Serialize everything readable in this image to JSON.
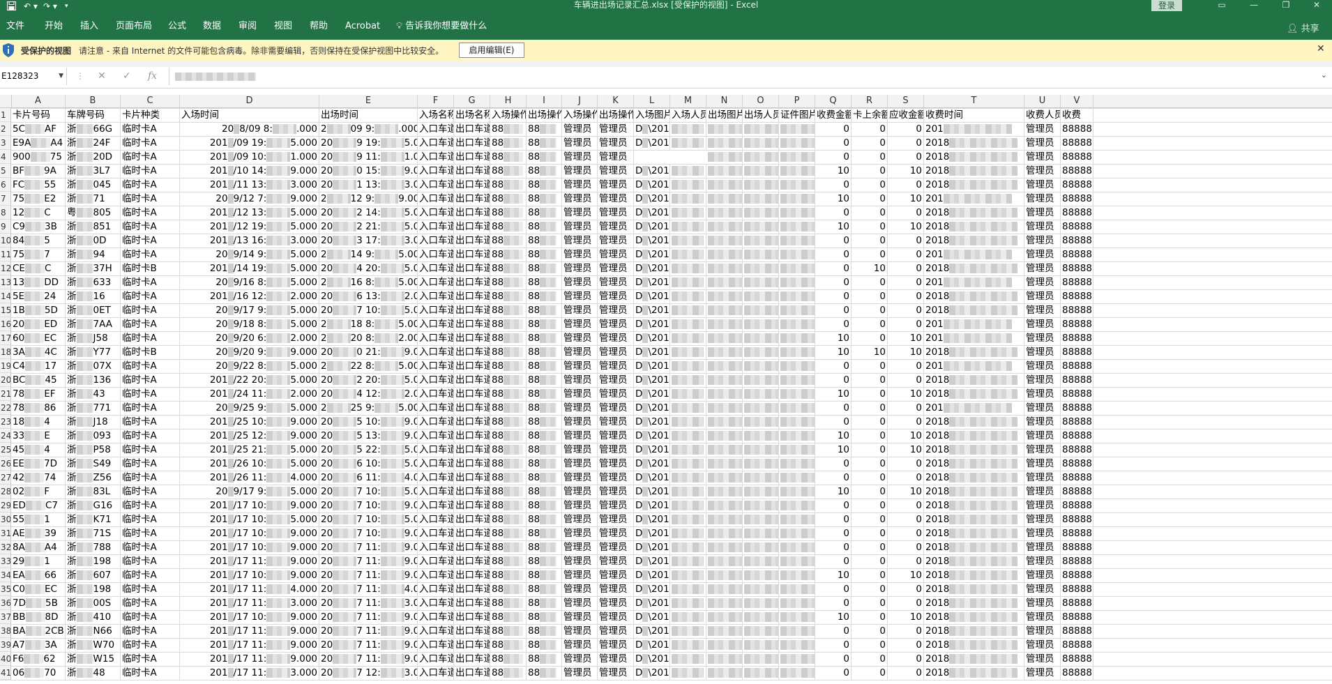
{
  "window": {
    "title": "车辆进出场记录汇总.xlsx  [受保护的视图]  -  Excel",
    "login": "登录",
    "share": "共享"
  },
  "ribbon": {
    "tabs": [
      "文件",
      "开始",
      "插入",
      "页面布局",
      "公式",
      "数据",
      "审阅",
      "视图",
      "帮助",
      "Acrobat"
    ],
    "tell_me": "告诉我你想要做什么"
  },
  "protected": {
    "label": "受保护的视图",
    "message": "请注意 - 来自 Internet 的文件可能包含病毒。除非需要编辑，否则保持在受保护视图中比较安全。",
    "enable_button": "启用编辑(E)"
  },
  "formula": {
    "name_box": "E128323",
    "fx": "fx"
  },
  "columns": [
    "A",
    "B",
    "C",
    "D",
    "E",
    "F",
    "G",
    "H",
    "I",
    "J",
    "K",
    "L",
    "M",
    "N",
    "O",
    "P",
    "Q",
    "R",
    "S",
    "T",
    "U",
    "V"
  ],
  "header_row": [
    "卡片号码",
    "车牌号码",
    "卡片种类",
    "入场时间",
    "出场时间",
    "入场名称",
    "出场名称",
    "入场操作",
    "出场操作",
    "入场操作",
    "出场操作",
    "入场图片",
    "入场人员",
    "出场图片",
    "出场人员",
    "证件图片",
    "收费金额",
    "卡上余额",
    "应收金额",
    "收费时间",
    "收费人员",
    "收费"
  ],
  "rows": [
    {
      "n": "2",
      "a": "5C",
      "a2": "AF",
      "b": "浙",
      "b2": "66G",
      "c": "临时卡A",
      "d1": "20",
      "d2": "8/09 8:",
      "e1": "2",
      "e2": "09 9:",
      "e3": ".000",
      "q": "0",
      "r": "0",
      "s": "0",
      "t": "201"
    },
    {
      "n": "3",
      "a": "E9A",
      "a2": "A4",
      "b": "浙",
      "b2": "24F",
      "c": "临时卡A",
      "d1": "201",
      "d2": "/09 19:",
      "e1": "20",
      "e2": "9 19:",
      "e3": "5.000",
      "q": "0",
      "r": "0",
      "s": "0",
      "t": "2018"
    },
    {
      "n": "4",
      "a": "900",
      "a2": "75",
      "b": "浙",
      "b2": "20D",
      "c": "临时卡A",
      "d1": "201",
      "d2": "/09 10:",
      "e1": "20",
      "e2": "9 11:",
      "e3": "1.000",
      "q": "0",
      "r": "0",
      "s": "0",
      "t": "2018"
    },
    {
      "n": "5",
      "a": "BF",
      "a2": "9A",
      "b": "浙",
      "b2": "3L7",
      "c": "临时卡A",
      "d1": "201",
      "d2": "/10 14:",
      "e1": "20",
      "e2": "0 15:",
      "e3": "9.000",
      "q": "10",
      "r": "0",
      "s": "10",
      "t": "2018"
    },
    {
      "n": "6",
      "a": "FC",
      "a2": "55",
      "b": "浙",
      "b2": "045",
      "c": "临时卡A",
      "d1": "201",
      "d2": "/11 13:",
      "e1": "20",
      "e2": "1 13:",
      "e3": "3.000",
      "q": "0",
      "r": "0",
      "s": "0",
      "t": "2018"
    },
    {
      "n": "7",
      "a": "75",
      "a2": "E2",
      "b": "浙",
      "b2": "71",
      "c": "临时卡A",
      "d1": "20",
      "d2": "9/12 7:",
      "e1": "2",
      "e2": "12 9:",
      "e3": "9.000",
      "q": "10",
      "r": "0",
      "s": "10",
      "t": "201"
    },
    {
      "n": "8",
      "a": "12",
      "a2": "C",
      "b": "粤",
      "b2": "805",
      "c": "临时卡A",
      "d1": "201",
      "d2": "/12 13:",
      "e1": "20",
      "e2": "2 14:",
      "e3": "5.000",
      "q": "0",
      "r": "0",
      "s": "0",
      "t": "2018"
    },
    {
      "n": "9",
      "a": "C9",
      "a2": "3B",
      "b": "浙",
      "b2": "851",
      "c": "临时卡A",
      "d1": "201",
      "d2": "/12 19:",
      "e1": "20",
      "e2": "2 21:",
      "e3": "5.000",
      "q": "10",
      "r": "0",
      "s": "10",
      "t": "2018"
    },
    {
      "n": "10",
      "a": "84",
      "a2": "5",
      "b": "浙",
      "b2": "0D",
      "c": "临时卡A",
      "d1": "201",
      "d2": "/13 16:",
      "e1": "20",
      "e2": "3 17:",
      "e3": "3.000",
      "q": "0",
      "r": "0",
      "s": "0",
      "t": "2018"
    },
    {
      "n": "11",
      "a": "75",
      "a2": "7",
      "b": "浙",
      "b2": "94",
      "c": "临时卡A",
      "d1": "20",
      "d2": "9/14 9:",
      "e1": "2",
      "e2": "14 9:",
      "e3": "5.000",
      "q": "0",
      "r": "0",
      "s": "0",
      "t": "201"
    },
    {
      "n": "12",
      "a": "CE",
      "a2": "C",
      "b": "浙",
      "b2": "37H",
      "c": "临时卡B",
      "d1": "201",
      "d2": "/14 19:",
      "e1": "20",
      "e2": "4 20:",
      "e3": "5.000",
      "q": "0",
      "r": "10",
      "s": "0",
      "t": "2018"
    },
    {
      "n": "13",
      "a": "13",
      "a2": "DD",
      "b": "浙",
      "b2": "633",
      "c": "临时卡A",
      "d1": "20",
      "d2": "9/16 8:",
      "e1": "2",
      "e2": "16 8:",
      "e3": "5.000",
      "q": "0",
      "r": "0",
      "s": "0",
      "t": "201"
    },
    {
      "n": "14",
      "a": "5E",
      "a2": "24",
      "b": "浙",
      "b2": "16",
      "c": "临时卡A",
      "d1": "201",
      "d2": "/16 12:",
      "e1": "20",
      "e2": "6 13:",
      "e3": "2.000",
      "q": "0",
      "r": "0",
      "s": "0",
      "t": "2018"
    },
    {
      "n": "15",
      "a": "1B",
      "a2": "5D",
      "b": "浙",
      "b2": "0ET",
      "c": "临时卡A",
      "d1": "20",
      "d2": "9/17 9:",
      "e1": "20",
      "e2": "7 10:",
      "e3": "5.000",
      "q": "0",
      "r": "0",
      "s": "0",
      "t": "2018"
    },
    {
      "n": "16",
      "a": "20",
      "a2": "ED",
      "b": "浙",
      "b2": "7AA",
      "c": "临时卡A",
      "d1": "20",
      "d2": "9/18 8:",
      "e1": "2",
      "e2": "18 8:",
      "e3": "5.000",
      "q": "0",
      "r": "0",
      "s": "0",
      "t": "201"
    },
    {
      "n": "17",
      "a": "60",
      "a2": "EC",
      "b": "浙",
      "b2": "J58",
      "c": "临时卡A",
      "d1": "20",
      "d2": "9/20 6:",
      "e1": "2",
      "e2": "20 8:",
      "e3": "2.000",
      "q": "10",
      "r": "0",
      "s": "10",
      "t": "201"
    },
    {
      "n": "18",
      "a": "3A",
      "a2": "4C",
      "b": "浙",
      "b2": "Y77",
      "c": "临时卡B",
      "d1": "20",
      "d2": "9/20 9:",
      "e1": "20",
      "e2": "0 21:",
      "e3": "9.000",
      "q": "10",
      "r": "10",
      "s": "10",
      "t": "2018"
    },
    {
      "n": "19",
      "a": "C4",
      "a2": "17",
      "b": "浙",
      "b2": "07X",
      "c": "临时卡A",
      "d1": "20",
      "d2": "9/22 8:",
      "e1": "2",
      "e2": "22 8:",
      "e3": "5.000",
      "q": "0",
      "r": "0",
      "s": "0",
      "t": "201"
    },
    {
      "n": "20",
      "a": "BC",
      "a2": "45",
      "b": "浙",
      "b2": "136",
      "c": "临时卡A",
      "d1": "201",
      "d2": "/22 20:",
      "e1": "20",
      "e2": "2 20:",
      "e3": "5.000",
      "q": "0",
      "r": "0",
      "s": "0",
      "t": "2018"
    },
    {
      "n": "21",
      "a": "78",
      "a2": "EF",
      "b": "浙",
      "b2": "43",
      "c": "临时卡A",
      "d1": "201",
      "d2": "/24 11:",
      "e1": "20",
      "e2": "4 12:",
      "e3": "2.000",
      "q": "10",
      "r": "0",
      "s": "10",
      "t": "2018"
    },
    {
      "n": "22",
      "a": "78",
      "a2": "86",
      "b": "浙",
      "b2": "771",
      "c": "临时卡A",
      "d1": "20",
      "d2": "9/25 9:",
      "e1": "2",
      "e2": "25 9:",
      "e3": "5.000",
      "q": "0",
      "r": "0",
      "s": "0",
      "t": "201"
    },
    {
      "n": "23",
      "a": "18",
      "a2": "4",
      "b": "浙",
      "b2": "J18",
      "c": "临时卡A",
      "d1": "201",
      "d2": "/25 10:",
      "e1": "20",
      "e2": "5 10:",
      "e3": "9.000",
      "q": "0",
      "r": "0",
      "s": "0",
      "t": "2018"
    },
    {
      "n": "24",
      "a": "33",
      "a2": "E",
      "b": "浙",
      "b2": "093",
      "c": "临时卡A",
      "d1": "201",
      "d2": "/25 12:",
      "e1": "20",
      "e2": "5 13:",
      "e3": "9.000",
      "q": "10",
      "r": "0",
      "s": "10",
      "t": "2018"
    },
    {
      "n": "25",
      "a": "45",
      "a2": "4",
      "b": "浙",
      "b2": "P58",
      "c": "临时卡A",
      "d1": "201",
      "d2": "/25 21:",
      "e1": "20",
      "e2": "5 22:",
      "e3": "5.000",
      "q": "10",
      "r": "0",
      "s": "10",
      "t": "2018"
    },
    {
      "n": "26",
      "a": "EE",
      "a2": "7D",
      "b": "浙",
      "b2": "S49",
      "c": "临时卡A",
      "d1": "201",
      "d2": "/26 10:",
      "e1": "20",
      "e2": "6 10:",
      "e3": "5.000",
      "q": "0",
      "r": "0",
      "s": "0",
      "t": "2018"
    },
    {
      "n": "27",
      "a": "42",
      "a2": "74",
      "b": "浙",
      "b2": "Z56",
      "c": "临时卡A",
      "d1": "201",
      "d2": "/26 11:",
      "e1": "20",
      "e2": "6 11:",
      "e3": "4.000",
      "q": "0",
      "r": "0",
      "s": "0",
      "t": "2018"
    },
    {
      "n": "28",
      "a": "02",
      "a2": "F",
      "b": "浙",
      "b2": "83L",
      "c": "临时卡A",
      "d1": "20",
      "d2": "9/17 9:",
      "e1": "20",
      "e2": "7 10:",
      "e3": "5.000",
      "q": "10",
      "r": "0",
      "s": "10",
      "t": "2018"
    },
    {
      "n": "29",
      "a": "ED",
      "a2": "C7",
      "b": "浙",
      "b2": "G16",
      "c": "临时卡A",
      "d1": "201",
      "d2": "/17 10:",
      "e1": "20",
      "e2": "7 10:",
      "e3": "9.000",
      "q": "0",
      "r": "0",
      "s": "0",
      "t": "2018"
    },
    {
      "n": "30",
      "a": "55",
      "a2": "1",
      "b": "浙",
      "b2": "K71",
      "c": "临时卡A",
      "d1": "201",
      "d2": "/17 10:",
      "e1": "20",
      "e2": "7 10:",
      "e3": "5.000",
      "q": "0",
      "r": "0",
      "s": "0",
      "t": "2018"
    },
    {
      "n": "31",
      "a": "AE",
      "a2": "39",
      "b": "浙",
      "b2": "71S",
      "c": "临时卡A",
      "d1": "201",
      "d2": "/17 10:",
      "e1": "20",
      "e2": "7 10:",
      "e3": "9.000",
      "q": "0",
      "r": "0",
      "s": "0",
      "t": "2018"
    },
    {
      "n": "32",
      "a": "8A",
      "a2": "A4",
      "b": "浙",
      "b2": "788",
      "c": "临时卡A",
      "d1": "201",
      "d2": "/17 10:",
      "e1": "20",
      "e2": "7 11:",
      "e3": "9.000",
      "q": "0",
      "r": "0",
      "s": "0",
      "t": "2018"
    },
    {
      "n": "33",
      "a": "29",
      "a2": "1",
      "b": "浙",
      "b2": "198",
      "c": "临时卡A",
      "d1": "201",
      "d2": "/17 11:",
      "e1": "20",
      "e2": "7 11:",
      "e3": "9.000",
      "q": "0",
      "r": "0",
      "s": "0",
      "t": "2018"
    },
    {
      "n": "34",
      "a": "EA",
      "a2": "66",
      "b": "浙",
      "b2": "607",
      "c": "临时卡A",
      "d1": "201",
      "d2": "/17 10:",
      "e1": "20",
      "e2": "7 11:",
      "e3": "9.000",
      "q": "10",
      "r": "0",
      "s": "10",
      "t": "2018"
    },
    {
      "n": "35",
      "a": "C0",
      "a2": "EC",
      "b": "浙",
      "b2": "198",
      "c": "临时卡A",
      "d1": "201",
      "d2": "/17 11:",
      "e1": "20",
      "e2": "7 11:",
      "e3": "4.000",
      "q": "0",
      "r": "0",
      "s": "0",
      "t": "2018"
    },
    {
      "n": "36",
      "a": "7D",
      "a2": "5B",
      "b": "浙",
      "b2": "00S",
      "c": "临时卡A",
      "d1": "201",
      "d2": "/17 11:",
      "e1": "20",
      "e2": "7 11:",
      "e3": "3.000",
      "q": "0",
      "r": "0",
      "s": "0",
      "t": "2018"
    },
    {
      "n": "37",
      "a": "BB",
      "a2": "8D",
      "b": "浙",
      "b2": "410",
      "c": "临时卡A",
      "d1": "201",
      "d2": "/17 10:",
      "e1": "20",
      "e2": "7 11:",
      "e3": "9.000",
      "q": "10",
      "r": "0",
      "s": "10",
      "t": "2018"
    },
    {
      "n": "38",
      "a": "BA",
      "a2": "2CB",
      "b": "浙",
      "b2": "N66",
      "c": "临时卡A",
      "d1": "201",
      "d2": "/17 11:",
      "e1": "20",
      "e2": "7 11:",
      "e3": "9.000",
      "q": "0",
      "r": "0",
      "s": "0",
      "t": "2018"
    },
    {
      "n": "39",
      "a": "A7",
      "a2": "3A",
      "b": "浙",
      "b2": "W70",
      "c": "临时卡A",
      "d1": "201",
      "d2": "/17 11:",
      "e1": "20",
      "e2": "7 11:",
      "e3": "9.000",
      "q": "0",
      "r": "0",
      "s": "0",
      "t": "2018"
    },
    {
      "n": "40",
      "a": "F6",
      "a2": "62",
      "b": "浙",
      "b2": "W15",
      "c": "临时卡A",
      "d1": "201",
      "d2": "/17 11:",
      "e1": "20",
      "e2": "7 11:",
      "e3": "9.000",
      "q": "0",
      "r": "0",
      "s": "0",
      "t": "2018"
    },
    {
      "n": "41",
      "a": "06",
      "a2": "70",
      "b": "浙",
      "b2": "48",
      "c": "临时卡A",
      "d1": "201",
      "d2": "/17 11:",
      "e1": "20",
      "e2": "7 12:",
      "e3": "3.000",
      "q": "0",
      "r": "0",
      "s": "0",
      "t": "2018"
    }
  ],
  "repeated": {
    "entry_name": "入口车道",
    "exit_name": "出口车道",
    "op_h": "88",
    "op_i": "88",
    "operator": "管理员",
    "path_l": "D",
    "path_l2": "\\2018",
    "fee_user": "管理员",
    "v": "88888"
  },
  "colors": {
    "excel_green": "#217346",
    "warning": "#fff6c4"
  }
}
